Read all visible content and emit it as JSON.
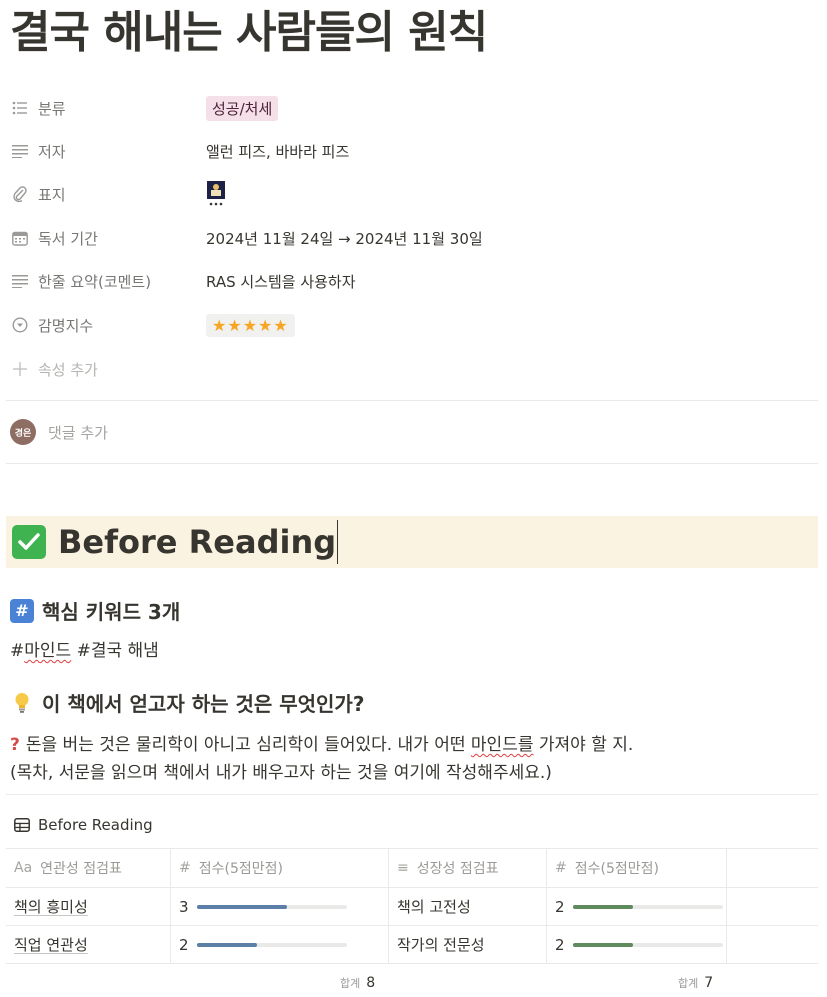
{
  "page": {
    "title": "결국 해내는 사람들의 원칙"
  },
  "properties": {
    "category": {
      "label": "분류",
      "value": "성공/처세",
      "tag_color": "#f5e0e9"
    },
    "author": {
      "label": "저자",
      "value": "앨런 피즈, 바바라 피즈"
    },
    "cover": {
      "label": "표지",
      "icon": "book-cover-thumbnail"
    },
    "period": {
      "label": "독서 기간",
      "value": "2024년 11월 24일 → 2024년 11월 30일"
    },
    "summary": {
      "label": "한줄 요약(코멘트)",
      "value": "RAS 시스템을 사용하자"
    },
    "rating": {
      "label": "감명지수",
      "value": "★★★★★",
      "stars": 5
    },
    "add_property": {
      "label": "속성 추가"
    }
  },
  "comment": {
    "avatar": "경은",
    "placeholder": "댓글 추가"
  },
  "callout": {
    "title": "Before Reading",
    "bg": "#fbf3e1",
    "icon_color": "#3fb34f"
  },
  "keywords": {
    "heading": "핵심 키워드 3개",
    "text_part1": "#",
    "text_squiggle": "마인드",
    "text_part2": " #결국 해냄"
  },
  "goal": {
    "heading": "이 책에서 얻고자 하는 것은 무엇인가?",
    "line1_part1": "돈을 버는 것은 물리학이 아니고 심리학이 들어있다. 내가 어떤 ",
    "line1_squiggle": "마인드를",
    "line1_part2": " 가져야 할 지.",
    "line2": "(목차, 서문을 읽으며 책에서 내가 배우고자 하는 것을 여기에 작성해주세요.)"
  },
  "database": {
    "title": "Before Reading",
    "columns": {
      "c1": {
        "icon": "Aa",
        "label": "연관성 점검표"
      },
      "c2": {
        "icon": "#",
        "label": "점수(5점만점)"
      },
      "c3": {
        "icon": "≡",
        "label": "성장성 점검표"
      },
      "c4": {
        "icon": "#",
        "label": "점수(5점만점)"
      }
    },
    "rows": [
      {
        "relevance": "책의 흥미성",
        "score1": 3,
        "growth": "책의 고전성",
        "score2": 2
      },
      {
        "relevance": "직업 연관성",
        "score1": 2,
        "growth": "작가의 전문성",
        "score2": 2
      }
    ],
    "sum1": {
      "label": "합계",
      "value": "8"
    },
    "sum2": {
      "label": "합계",
      "value": "7"
    },
    "bar_color_1": "#5b7fa6",
    "bar_color_2": "#5e8a5e"
  }
}
